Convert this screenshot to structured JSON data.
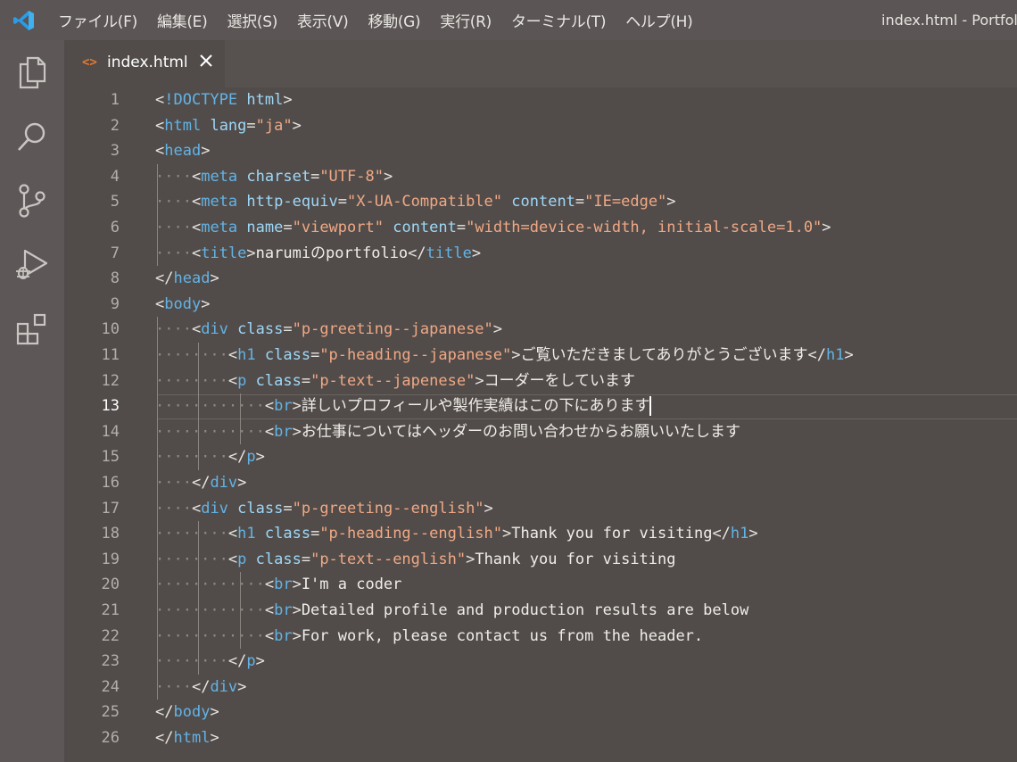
{
  "titlebar": {
    "menu": [
      "ファイル(F)",
      "編集(E)",
      "選択(S)",
      "表示(V)",
      "移動(G)",
      "実行(R)",
      "ターミナル(T)",
      "ヘルプ(H)"
    ],
    "window_title": "index.html - Portfol"
  },
  "activity_bar": [
    "explorer-icon",
    "search-icon",
    "source-control-icon",
    "run-debug-icon",
    "extensions-icon"
  ],
  "tab": {
    "icon_text": "<>",
    "label": "index.html"
  },
  "editor": {
    "active_line": 13,
    "colors": {
      "tag": "#62b3e6",
      "attribute": "#9ed7f7",
      "string": "#f0a884",
      "text": "#f0ede8"
    },
    "lines": [
      {
        "n": "1",
        "segs": [
          [
            "t",
            "<"
          ],
          [
            "tg",
            "!DOCTYPE"
          ],
          [
            "t",
            " "
          ],
          [
            "an",
            "html"
          ],
          [
            "t",
            ">"
          ]
        ]
      },
      {
        "n": "2",
        "segs": [
          [
            "t",
            "<"
          ],
          [
            "tg",
            "html"
          ],
          [
            "t",
            " "
          ],
          [
            "an",
            "lang"
          ],
          [
            "t",
            "="
          ],
          [
            "av",
            "\"ja\""
          ],
          [
            "t",
            ">"
          ]
        ]
      },
      {
        "n": "3",
        "segs": [
          [
            "t",
            "<"
          ],
          [
            "tg",
            "head"
          ],
          [
            "t",
            ">"
          ]
        ]
      },
      {
        "n": "4",
        "indent": 1,
        "segs": [
          [
            "t",
            "<"
          ],
          [
            "tg",
            "meta"
          ],
          [
            "t",
            " "
          ],
          [
            "an",
            "charset"
          ],
          [
            "t",
            "="
          ],
          [
            "av",
            "\"UTF-8\""
          ],
          [
            "t",
            ">"
          ]
        ]
      },
      {
        "n": "5",
        "indent": 1,
        "segs": [
          [
            "t",
            "<"
          ],
          [
            "tg",
            "meta"
          ],
          [
            "t",
            " "
          ],
          [
            "an",
            "http-equiv"
          ],
          [
            "t",
            "="
          ],
          [
            "av",
            "\"X-UA-Compatible\""
          ],
          [
            "t",
            " "
          ],
          [
            "an",
            "content"
          ],
          [
            "t",
            "="
          ],
          [
            "av",
            "\"IE=edge\""
          ],
          [
            "t",
            ">"
          ]
        ]
      },
      {
        "n": "6",
        "indent": 1,
        "segs": [
          [
            "t",
            "<"
          ],
          [
            "tg",
            "meta"
          ],
          [
            "t",
            " "
          ],
          [
            "an",
            "name"
          ],
          [
            "t",
            "="
          ],
          [
            "av",
            "\"viewport\""
          ],
          [
            "t",
            " "
          ],
          [
            "an",
            "content"
          ],
          [
            "t",
            "="
          ],
          [
            "av",
            "\"width=device-width, initial-scale=1.0\""
          ],
          [
            "t",
            ">"
          ]
        ]
      },
      {
        "n": "7",
        "indent": 1,
        "segs": [
          [
            "t",
            "<"
          ],
          [
            "tg",
            "title"
          ],
          [
            "t",
            ">"
          ],
          [
            "tx",
            "narumiのportfolio"
          ],
          [
            "t",
            "</"
          ],
          [
            "tg",
            "title"
          ],
          [
            "t",
            ">"
          ]
        ]
      },
      {
        "n": "8",
        "segs": [
          [
            "t",
            "</"
          ],
          [
            "tg",
            "head"
          ],
          [
            "t",
            ">"
          ]
        ]
      },
      {
        "n": "9",
        "segs": [
          [
            "t",
            "<"
          ],
          [
            "tg",
            "body"
          ],
          [
            "t",
            ">"
          ]
        ]
      },
      {
        "n": "10",
        "indent": 1,
        "segs": [
          [
            "t",
            "<"
          ],
          [
            "tg",
            "div"
          ],
          [
            "t",
            " "
          ],
          [
            "an",
            "class"
          ],
          [
            "t",
            "="
          ],
          [
            "av",
            "\"p-greeting--japanese\""
          ],
          [
            "t",
            ">"
          ]
        ]
      },
      {
        "n": "11",
        "indent": 2,
        "segs": [
          [
            "t",
            "<"
          ],
          [
            "tg",
            "h1"
          ],
          [
            "t",
            " "
          ],
          [
            "an",
            "class"
          ],
          [
            "t",
            "="
          ],
          [
            "av",
            "\"p-heading--japanese\""
          ],
          [
            "t",
            ">"
          ],
          [
            "tx",
            "ご覧いただきましてありがとうございます"
          ],
          [
            "t",
            "</"
          ],
          [
            "tg",
            "h1"
          ],
          [
            "t",
            ">"
          ]
        ]
      },
      {
        "n": "12",
        "indent": 2,
        "segs": [
          [
            "t",
            "<"
          ],
          [
            "tg",
            "p"
          ],
          [
            "t",
            " "
          ],
          [
            "an",
            "class"
          ],
          [
            "t",
            "="
          ],
          [
            "av",
            "\"p-text--japenese\""
          ],
          [
            "t",
            ">"
          ],
          [
            "tx",
            "コーダーをしています"
          ]
        ]
      },
      {
        "n": "13",
        "indent": 3,
        "segs": [
          [
            "t",
            "<"
          ],
          [
            "tg",
            "br"
          ],
          [
            "t",
            ">"
          ],
          [
            "tx",
            "詳しいプロフィールや製作実績はこの下にあります"
          ]
        ]
      },
      {
        "n": "14",
        "indent": 3,
        "segs": [
          [
            "t",
            "<"
          ],
          [
            "tg",
            "br"
          ],
          [
            "t",
            ">"
          ],
          [
            "tx",
            "お仕事についてはヘッダーのお問い合わせからお願いいたします"
          ]
        ]
      },
      {
        "n": "15",
        "indent": 2,
        "segs": [
          [
            "t",
            "</"
          ],
          [
            "tg",
            "p"
          ],
          [
            "t",
            ">"
          ]
        ]
      },
      {
        "n": "16",
        "indent": 1,
        "segs": [
          [
            "t",
            "</"
          ],
          [
            "tg",
            "div"
          ],
          [
            "t",
            ">"
          ]
        ]
      },
      {
        "n": "17",
        "indent": 1,
        "segs": [
          [
            "t",
            "<"
          ],
          [
            "tg",
            "div"
          ],
          [
            "t",
            " "
          ],
          [
            "an",
            "class"
          ],
          [
            "t",
            "="
          ],
          [
            "av",
            "\"p-greeting--english\""
          ],
          [
            "t",
            ">"
          ]
        ]
      },
      {
        "n": "18",
        "indent": 2,
        "segs": [
          [
            "t",
            "<"
          ],
          [
            "tg",
            "h1"
          ],
          [
            "t",
            " "
          ],
          [
            "an",
            "class"
          ],
          [
            "t",
            "="
          ],
          [
            "av",
            "\"p-heading--english\""
          ],
          [
            "t",
            ">"
          ],
          [
            "tx",
            "Thank you for visiting"
          ],
          [
            "t",
            "</"
          ],
          [
            "tg",
            "h1"
          ],
          [
            "t",
            ">"
          ]
        ]
      },
      {
        "n": "19",
        "indent": 2,
        "segs": [
          [
            "t",
            "<"
          ],
          [
            "tg",
            "p"
          ],
          [
            "t",
            " "
          ],
          [
            "an",
            "class"
          ],
          [
            "t",
            "="
          ],
          [
            "av",
            "\"p-text--english\""
          ],
          [
            "t",
            ">"
          ],
          [
            "tx",
            "Thank you for visiting"
          ]
        ]
      },
      {
        "n": "20",
        "indent": 3,
        "segs": [
          [
            "t",
            "<"
          ],
          [
            "tg",
            "br"
          ],
          [
            "t",
            ">"
          ],
          [
            "tx",
            "I'm a coder"
          ]
        ]
      },
      {
        "n": "21",
        "indent": 3,
        "segs": [
          [
            "t",
            "<"
          ],
          [
            "tg",
            "br"
          ],
          [
            "t",
            ">"
          ],
          [
            "tx",
            "Detailed profile and production results are below"
          ]
        ]
      },
      {
        "n": "22",
        "indent": 3,
        "segs": [
          [
            "t",
            "<"
          ],
          [
            "tg",
            "br"
          ],
          [
            "t",
            ">"
          ],
          [
            "tx",
            "For work, please contact us from the header."
          ]
        ]
      },
      {
        "n": "23",
        "indent": 2,
        "segs": [
          [
            "t",
            "</"
          ],
          [
            "tg",
            "p"
          ],
          [
            "t",
            ">"
          ]
        ]
      },
      {
        "n": "24",
        "indent": 1,
        "segs": [
          [
            "t",
            "</"
          ],
          [
            "tg",
            "div"
          ],
          [
            "t",
            ">"
          ]
        ]
      },
      {
        "n": "25",
        "segs": [
          [
            "t",
            "</"
          ],
          [
            "tg",
            "body"
          ],
          [
            "t",
            ">"
          ]
        ]
      },
      {
        "n": "26",
        "segs": [
          [
            "t",
            "</"
          ],
          [
            "tg",
            "html"
          ],
          [
            "t",
            ">"
          ]
        ]
      }
    ]
  }
}
